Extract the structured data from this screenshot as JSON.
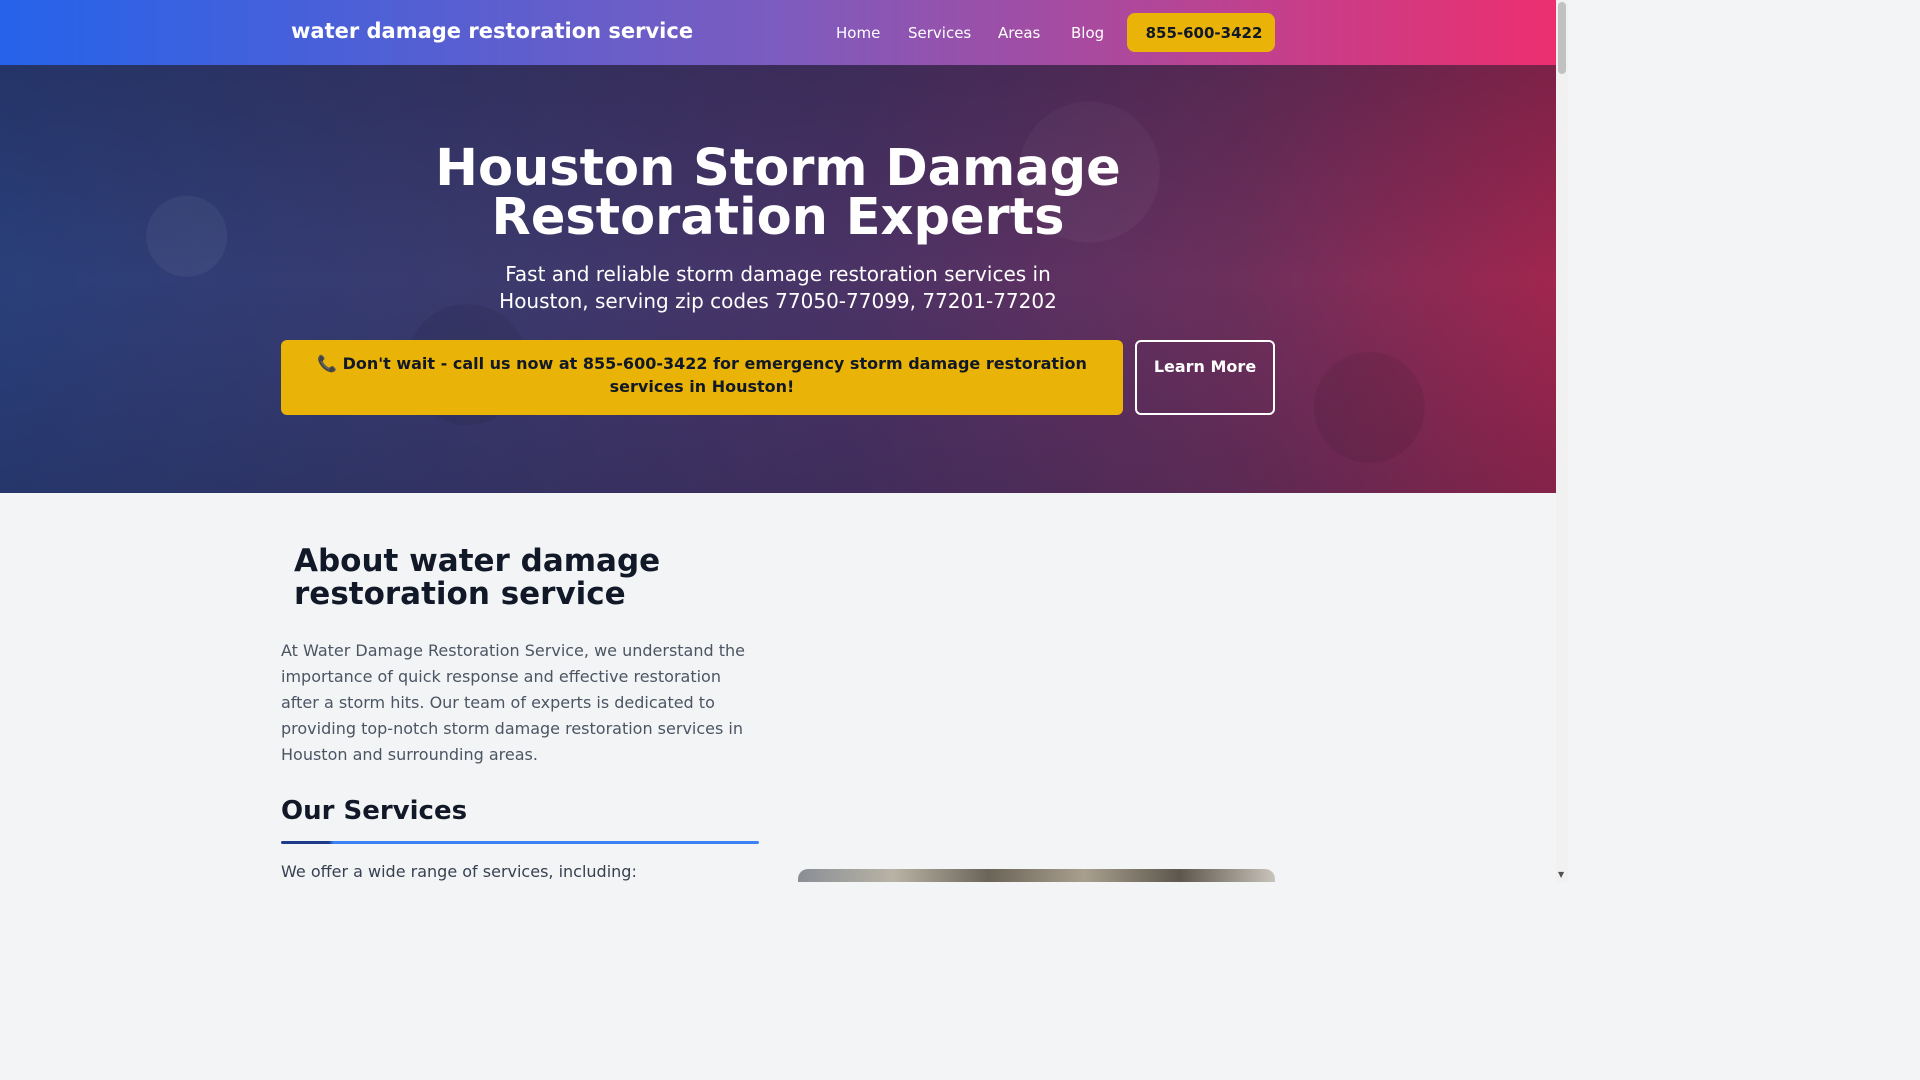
{
  "navbar": {
    "brand": "water damage restoration service",
    "links": [
      "Home",
      "Services",
      "Areas",
      "Blog"
    ],
    "phone": "855-600-3422"
  },
  "hero": {
    "title": "Houston Storm Damage Restoration Experts",
    "subtitle": "Fast and reliable storm damage restoration services in Houston, serving zip codes 77050-77099, 77201-77202",
    "cta_icon": "📞",
    "cta_text": "Don't wait - call us now at 855-600-3422 for emergency storm damage restoration services in Houston!",
    "learn_more": "Learn More"
  },
  "about": {
    "title": "About water damage restoration service",
    "text": "At Water Damage Restoration Service, we understand the importance of quick response and effective restoration after a storm hits. Our team of experts is dedicated to providing top-notch storm damage restoration services in Houston and surrounding areas."
  },
  "services": {
    "title": "Our Services",
    "intro": "We offer a wide range of services, including:"
  },
  "colors": {
    "accent_yellow": "#eab308",
    "nav_gradient_start": "#2563eb",
    "nav_gradient_end": "#ec2f6f"
  }
}
